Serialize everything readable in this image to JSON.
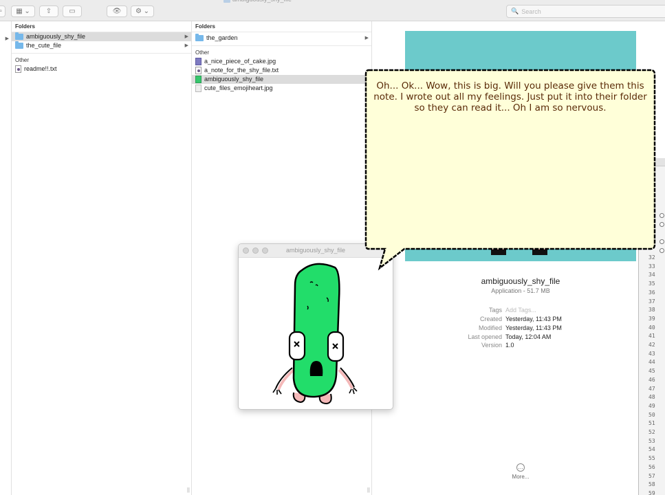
{
  "window": {
    "title": "ambiguously_shy_file"
  },
  "toolbar": {
    "search_placeholder": "Search"
  },
  "column1": {
    "folders_header": "Folders",
    "folders": [
      "ambiguously_shy_file",
      "the_cute_file"
    ],
    "other_header": "Other",
    "other_items": [
      "readme!!.txt"
    ]
  },
  "column2": {
    "folders_header": "Folders",
    "folders": [
      "the_garden"
    ],
    "other_header": "Other",
    "other_items": [
      "a_nice_piece_of_cake.jpg",
      "a_note_for_the_shy_file.txt",
      "ambiguously_shy_file",
      "cute_files_emojiheart.jpg"
    ]
  },
  "preview": {
    "name": "ambiguously_shy_file",
    "kind": "Application - 51.7 MB",
    "tags_label": "Tags",
    "tags_placeholder": "Add Tags...",
    "created_label": "Created",
    "created_value": "Yesterday, 11:43 PM",
    "modified_label": "Modified",
    "modified_value": "Yesterday, 11:43 PM",
    "last_opened_label": "Last opened",
    "last_opened_value": "Today, 12:04 AM",
    "version_label": "Version",
    "version_value": "1.0",
    "more_label": "More..."
  },
  "image_window": {
    "title": "ambiguously_shy_file"
  },
  "speech": {
    "text": "Oh... Ok... Wow, this is big. Will you please give them this note. I wrote out all my feelings. Just put it into their folder so they can read it... Oh I am so nervous."
  },
  "gutter": {
    "numbers": [
      "32",
      "33",
      "34",
      "35",
      "36",
      "37",
      "38",
      "39",
      "40",
      "41",
      "42",
      "43",
      "44",
      "45",
      "46",
      "47",
      "48",
      "49",
      "50",
      "51",
      "52",
      "53",
      "54",
      "55",
      "56",
      "57",
      "58",
      "59"
    ]
  },
  "icons": {
    "character": "green-pickle-character"
  }
}
